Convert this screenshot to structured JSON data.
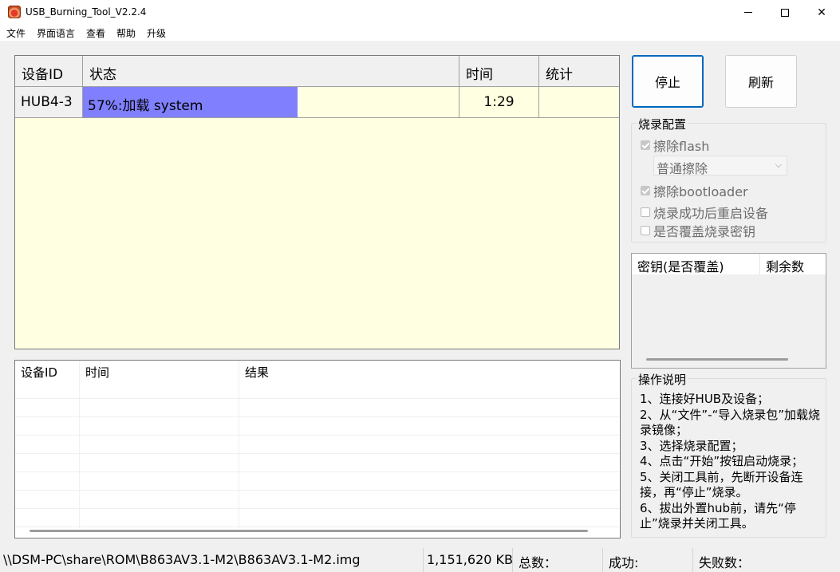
{
  "window": {
    "title": "USB_Burning_Tool_V2.2.4"
  },
  "menu": [
    "文件",
    "界面语言",
    "查看",
    "帮助",
    "升级"
  ],
  "device_table": {
    "headers": [
      "设备ID",
      "状态",
      "时间",
      "统计"
    ],
    "rows": [
      {
        "device_id": "HUB4-3",
        "status": "57%:加载 system",
        "progress": 0.57,
        "time": "1:29",
        "stat": ""
      }
    ],
    "background": "#ffffe1",
    "progress_color": "#8080ff"
  },
  "log_table": {
    "headers": [
      "设备ID",
      "时间",
      "结果"
    ]
  },
  "buttons": {
    "stop": "停止",
    "refresh": "刷新"
  },
  "burn_config": {
    "title": "烧录配置",
    "erase_flash": {
      "label": "擦除flash",
      "checked": true,
      "enabled": false
    },
    "erase_mode": {
      "value": "普通擦除"
    },
    "erase_bootloader": {
      "label": "擦除bootloader",
      "checked": true,
      "enabled": false
    },
    "reboot_after": {
      "label": "烧录成功后重启设备",
      "checked": false
    },
    "overwrite_key": {
      "label": "是否覆盖烧录密钥",
      "checked": false
    }
  },
  "key_table": {
    "headers": [
      "密钥(是否覆盖)",
      "剩余数"
    ]
  },
  "instructions": {
    "title": "操作说明",
    "lines": [
      "1、连接好HUB及设备；",
      "2、从“文件”-“导入烧录包”加载烧录镜像；",
      "3、选择烧录配置；",
      "4、点击“开始”按钮启动烧录；",
      "5、关闭工具前，先断开设备连接，再“停止”烧录。",
      "6、拔出外置hub前，请先“停止”烧录并关闭工具。"
    ]
  },
  "statusbar": {
    "path": "\\\\DSM-PC\\share\\ROM\\B863AV3.1-M2\\B863AV3.1-M2.img",
    "size": "1,151,620 KB",
    "total": "总数：",
    "success": "成功:",
    "failed": "失败数："
  }
}
